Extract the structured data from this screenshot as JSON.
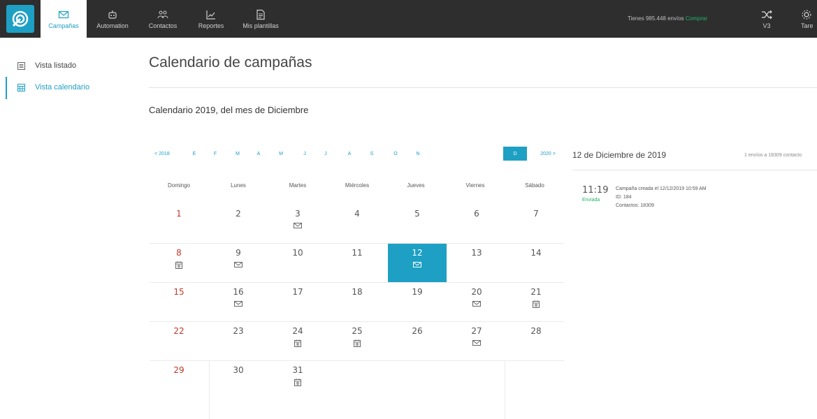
{
  "topbar": {
    "nav": [
      {
        "label": "Campañas",
        "icon": "envelope-icon",
        "active": true
      },
      {
        "label": "Automation",
        "icon": "robot-icon"
      },
      {
        "label": "Contactos",
        "icon": "contacts-icon"
      },
      {
        "label": "Reportes",
        "icon": "chart-icon"
      },
      {
        "label": "Mis plantillas",
        "icon": "template-icon"
      }
    ],
    "sends_text": "Tienes 985.448 envíos",
    "sends_link": "Comprar",
    "v3_label": "V3",
    "tasks_label": "Tare"
  },
  "sidebar": {
    "items": [
      {
        "label": "Vista listado",
        "icon": "list-view-icon"
      },
      {
        "label": "Vista calendario",
        "icon": "calendar-view-icon",
        "active": true
      }
    ]
  },
  "main": {
    "title": "Calendario de campañas",
    "subtitle": "Calendario 2019, del mes de Diciembre",
    "months": [
      "< 2018",
      "E",
      "F",
      "M",
      "A",
      "M",
      "J",
      "J",
      "A",
      "S",
      "O",
      "N",
      "D",
      "2020 >"
    ],
    "selected_month": "D",
    "weekdays": [
      "Domingo",
      "Lunes",
      "Martes",
      "Miércoles",
      "Jueves",
      "Viernes",
      "Sábado"
    ],
    "days": [
      {
        "n": "1",
        "icon": ""
      },
      {
        "n": "2",
        "icon": ""
      },
      {
        "n": "3",
        "icon": "envelope-icon"
      },
      {
        "n": "4",
        "icon": ""
      },
      {
        "n": "5",
        "icon": ""
      },
      {
        "n": "6",
        "icon": ""
      },
      {
        "n": "7",
        "icon": ""
      },
      {
        "n": "8",
        "icon": "calendar-icon"
      },
      {
        "n": "9",
        "icon": "envelope-icon"
      },
      {
        "n": "10",
        "icon": ""
      },
      {
        "n": "11",
        "icon": ""
      },
      {
        "n": "12",
        "icon": "envelope-icon",
        "selected": true
      },
      {
        "n": "13",
        "icon": ""
      },
      {
        "n": "14",
        "icon": ""
      },
      {
        "n": "15",
        "icon": ""
      },
      {
        "n": "16",
        "icon": "envelope-icon"
      },
      {
        "n": "17",
        "icon": ""
      },
      {
        "n": "18",
        "icon": ""
      },
      {
        "n": "19",
        "icon": ""
      },
      {
        "n": "20",
        "icon": "envelope-icon"
      },
      {
        "n": "21",
        "icon": "calendar-icon"
      },
      {
        "n": "22",
        "icon": ""
      },
      {
        "n": "23",
        "icon": ""
      },
      {
        "n": "24",
        "icon": "calendar-icon"
      },
      {
        "n": "25",
        "icon": "calendar-icon"
      },
      {
        "n": "26",
        "icon": ""
      },
      {
        "n": "27",
        "icon": "envelope-icon"
      },
      {
        "n": "28",
        "icon": ""
      },
      {
        "n": "29",
        "icon": ""
      },
      {
        "n": "30",
        "icon": ""
      },
      {
        "n": "31",
        "icon": "calendar-icon"
      }
    ]
  },
  "detail": {
    "date": "12 de Diciembre de 2019",
    "count": "1 envíos a 18309 contacto",
    "time": "11:19",
    "status": "Enviada",
    "line1": "Campaña creada el 12/12/2019 10:59 AM",
    "line2": "ID: 184",
    "line3": "Contactos: 18309"
  },
  "colors": {
    "accent": "#1ea0c4",
    "topbar": "#2e2e2e",
    "sunday": "#c0392b",
    "sent": "#21b36b"
  }
}
